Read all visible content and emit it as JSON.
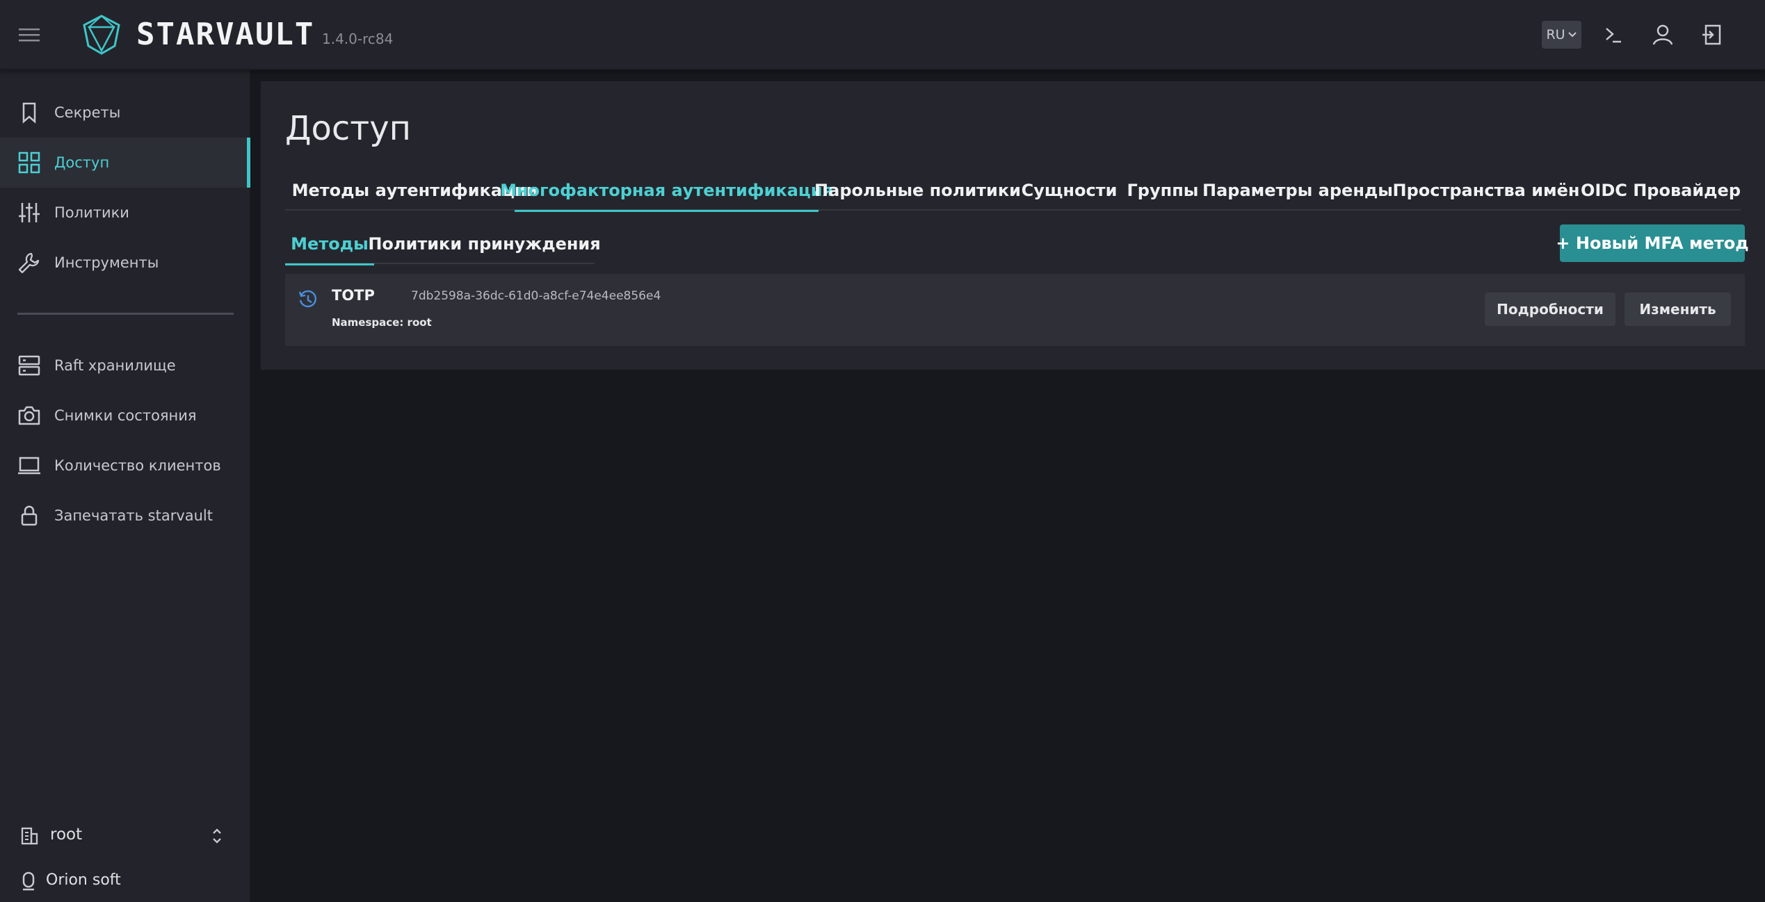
{
  "header": {
    "brand": "STARVAULT",
    "version": "1.4.0-rc84",
    "lang": "RU",
    "icons": [
      "menu-icon",
      "logo-icon",
      "terminal-icon",
      "user-icon",
      "logout-icon"
    ]
  },
  "sidebar": {
    "items": [
      {
        "label": "Секреты",
        "icon": "bookmark-icon"
      },
      {
        "label": "Доступ",
        "icon": "grid-icon",
        "active": true
      },
      {
        "label": "Политики",
        "icon": "sliders-icon"
      },
      {
        "label": "Инструменты",
        "icon": "wrench-icon"
      },
      {
        "label": "Raft хранилище",
        "icon": "server-icon"
      },
      {
        "label": "Снимки состояния",
        "icon": "camera-icon"
      },
      {
        "label": "Количество клиентов",
        "icon": "monitor-icon"
      },
      {
        "label": "Запечатать starvault",
        "icon": "lock-icon"
      }
    ],
    "namespace": "root",
    "org": "Orion soft"
  },
  "main": {
    "title": "Доступ",
    "tabs": [
      {
        "label": "Методы аутентификации"
      },
      {
        "label": "Многофакторная аутентификация",
        "active": true
      },
      {
        "label": "Парольные политики"
      },
      {
        "label": "Сущности"
      },
      {
        "label": "Группы"
      },
      {
        "label": "Параметры аренды"
      },
      {
        "label": "Пространства имён"
      },
      {
        "label": "OIDC Провайдер"
      }
    ],
    "subtabs": [
      {
        "label": "Методы",
        "active": true
      },
      {
        "label": "Политики принуждения"
      }
    ],
    "new_button": "+ Новый MFA метод",
    "methods": [
      {
        "type": "TOTP",
        "id": "7db2598a-36dc-61d0-a8cf-e74e4ee856e4",
        "namespace": "Namespace: root",
        "details_label": "Подробности",
        "edit_label": "Изменить"
      }
    ]
  },
  "colors": {
    "accent": "#3fc6c9",
    "button": "#2a8f92",
    "sidebar_bg": "#23242b",
    "page_bg": "#17181d"
  }
}
